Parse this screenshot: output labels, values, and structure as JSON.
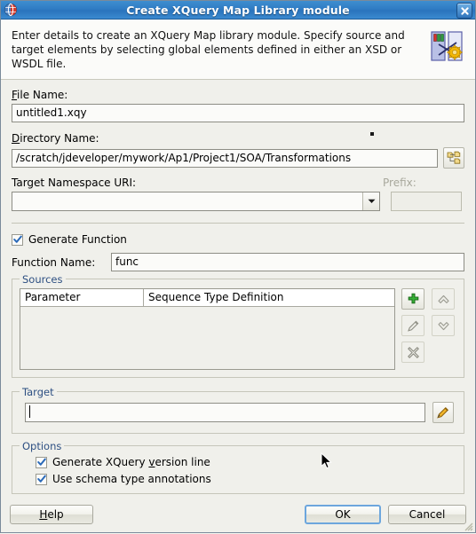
{
  "window": {
    "title": "Create XQuery Map Library module",
    "icon": "app-globe-icon",
    "close_icon": "close-icon"
  },
  "header": {
    "description": "Enter details to create an XQuery Map library module. Specify source and target elements by selecting global elements defined in either an XSD or WSDL file.",
    "illustration_icon": "xquery-map-illustration-icon"
  },
  "form": {
    "file_name": {
      "label": "File Name:",
      "mnemonic": "F",
      "value": "untitled1.xqy"
    },
    "directory_name": {
      "label": "Directory Name:",
      "mnemonic": "D",
      "value": "/scratch/jdeveloper/mywork/Ap1/Project1/SOA/Transformations",
      "browse_icon": "folder-tree-browse-icon"
    },
    "target_namespace": {
      "label": "Target Namespace URI:",
      "value": "",
      "dropdown_icon": "chevron-down-icon"
    },
    "prefix": {
      "label": "Prefix:",
      "value": "",
      "disabled": true
    },
    "generate_function": {
      "label": "Generate Function",
      "checked": true
    },
    "function_name": {
      "label": "Function Name:",
      "value": "func"
    }
  },
  "sources": {
    "title": "Sources",
    "columns": [
      "Parameter",
      "Sequence Type Definition"
    ],
    "rows": [],
    "buttons": [
      {
        "name": "add-source-button",
        "icon": "plus-icon",
        "enabled": true
      },
      {
        "name": "move-up-source-button",
        "icon": "chevron-up-icon",
        "enabled": false
      },
      {
        "name": "edit-source-button",
        "icon": "pencil-icon",
        "enabled": false
      },
      {
        "name": "move-down-source-button",
        "icon": "chevron-down-icon",
        "enabled": false
      },
      {
        "name": "delete-source-button",
        "icon": "x-cross-icon",
        "enabled": false
      }
    ]
  },
  "target": {
    "title": "Target",
    "value": "",
    "edit_icon": "pencil-icon"
  },
  "options": {
    "title": "Options",
    "items": [
      {
        "label": "Generate XQuery version line",
        "checked": true,
        "mnemonic": "v"
      },
      {
        "label": "Use schema type annotations",
        "checked": true
      }
    ]
  },
  "footer": {
    "help_label": "Help",
    "help_mnemonic": "H",
    "ok_label": "OK",
    "cancel_label": "Cancel"
  },
  "colors": {
    "titlebar_blue": "#2f7cc4",
    "group_title": "#2d4f82",
    "background": "#f0f0eb",
    "field_background": "#fbfbf9",
    "accent_green": "#3faa3f",
    "focus_blue": "#6ca6dd"
  }
}
